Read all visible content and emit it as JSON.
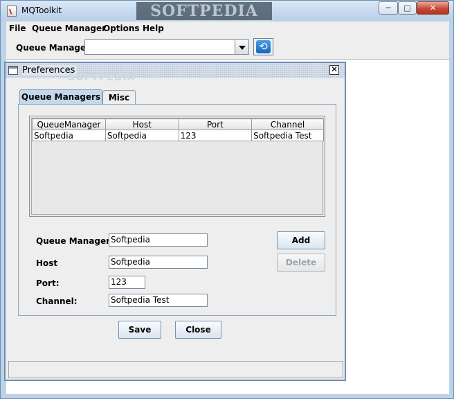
{
  "window": {
    "title": "MQToolkit",
    "watermark": "SOFTPEDIA",
    "min_glyph": "─",
    "max_glyph": "□",
    "close_glyph": "✕"
  },
  "menubar": {
    "items": [
      {
        "label": "File"
      },
      {
        "label": "Queue Manager"
      },
      {
        "label": "Options"
      },
      {
        "label": "Help"
      }
    ]
  },
  "toolbar": {
    "queue_manager_label": "Queue Manager:",
    "queue_manager_value": "",
    "refresh_glyph": "⟲"
  },
  "preferences": {
    "title": "Preferences",
    "watermark": "SOFTPEDIA",
    "close_glyph": "✕",
    "tabs": [
      {
        "label": "Queue Managers",
        "active": true
      },
      {
        "label": "Misc",
        "active": false
      }
    ],
    "table": {
      "columns": [
        "QueueManager",
        "Host",
        "Port",
        "Channel"
      ],
      "rows": [
        [
          "Softpedia",
          "Softpedia",
          "123",
          "Softpedia Test"
        ]
      ]
    },
    "form": {
      "queue_manager_label": "Queue Manager:",
      "queue_manager_value": "Softpedia",
      "host_label": "Host",
      "host_value": "Softpedia",
      "port_label": "Port:",
      "port_value": "123",
      "channel_label": "Channel:",
      "channel_value": "Softpedia Test"
    },
    "buttons": {
      "add": "Add",
      "delete": "Delete",
      "save": "Save",
      "close": "Close"
    }
  },
  "colors": {
    "title_bar": "#c3d8ee",
    "close_button": "#c74a33",
    "active_tab": "#c4d8ec",
    "frame_border": "#6e8fb5"
  }
}
